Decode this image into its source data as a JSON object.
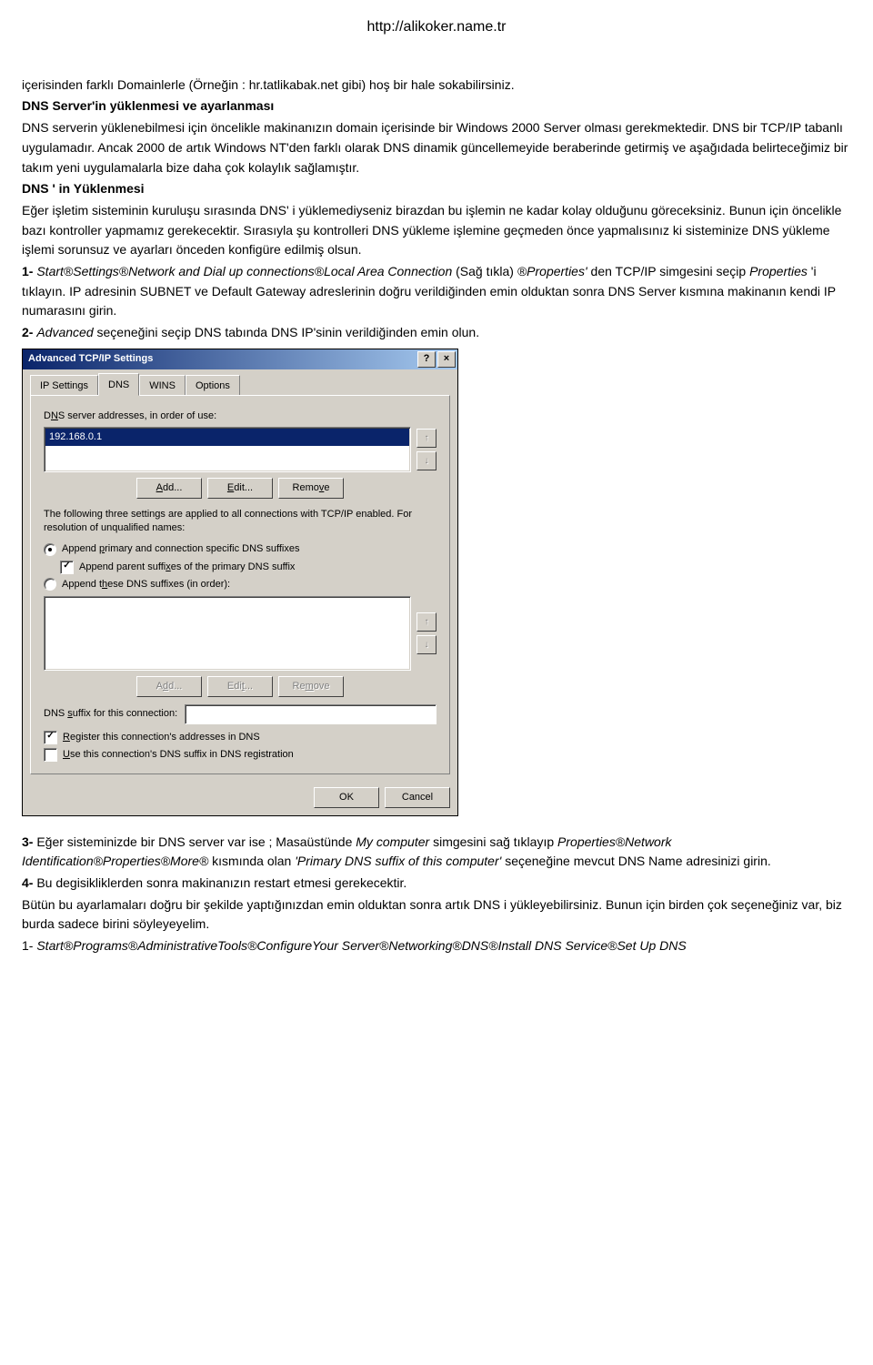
{
  "header_url": "http://alikoker.name.tr",
  "doc": {
    "p1": "içerisinden farklı Domainlerle (Örneğin : hr.tatlikabak.net gibi) hoş bir hale sokabilirsiniz.",
    "h1": "DNS Server'in yüklenmesi ve ayarlanması",
    "p2": "DNS serverin yüklenebilmesi için öncelikle makinanızın domain içerisinde bir Windows 2000 Server olması gerekmektedir. DNS bir TCP/IP tabanlı uygulamadır. Ancak 2000 de artık Windows NT'den farklı olarak DNS dinamik güncellemeyide beraberinde getirmiş ve aşağıdada belirteceğimiz bir takım yeni uygulamalarla bize daha çok kolaylık sağlamıştır.",
    "h2": "DNS ' in Yüklenmesi",
    "p3": "Eğer işletim sisteminin kuruluşu sırasında DNS' i yüklemediyseniz birazdan bu işlemin ne kadar kolay olduğunu göreceksiniz. Bunun için öncelikle bazı kontroller yapmamız gerekecektir. Sırasıyla şu kontrolleri DNS yükleme işlemine geçmeden önce yapmalısınız ki sisteminize DNS yükleme işlemi sorunsuz ve ayarları önceden konfigüre edilmiş olsun.",
    "step1_a": "1- ",
    "step1_i": "Start®Settings®Network and Dial up connections®Local Area Connection",
    "step1_b": "(Sağ tıkla) ",
    "step1_i2": "®Properties'",
    "step1_c": " den TCP/IP simgesini seçip ",
    "step1_i3": "Properties",
    "step1_d": "'i tıklayın. IP adresinin SUBNET ve Default Gateway adreslerinin doğru verildiğinden emin olduktan sonra DNS Server kısmına makinanın kendi IP numarasını girin.",
    "step2_a": "2- ",
    "step2_i": "Advanced",
    "step2_b": " seçeneğini seçip DNS tabında DNS IP'sinin verildiğinden emin olun.",
    "step3_a": "3- ",
    "step3_b": "Eğer sisteminizde bir DNS server var ise ; Masaüstünde ",
    "step3_i1": "My computer",
    "step3_c": " simgesini sağ tıklayıp ",
    "step3_i2": "Properties®Network Identification®Properties®More®",
    "step3_d": " kısmında olan ",
    "step3_i3": "'Primary DNS suffix of this computer'",
    "step3_e": " seçeneğine mevcut DNS Name adresinizi girin.",
    "step4_a": "4- ",
    "step4_b": "Bu degisikliklerden sonra makinanızın restart etmesi gerekecektir.",
    "p4": "Bütün bu ayarlamaları doğru bir şekilde yaptığınızdan emin olduktan sonra artık DNS i yükleyebilirsiniz. Bunun için birden çok seçeneğiniz var, biz burda sadece birini söyleyeyelim.",
    "p5_a": "1- ",
    "p5_i": "Start®Programs®AdministrativeTools®ConfigureYour Server®Networking®DNS®Install DNS Service®Set Up DNS"
  },
  "dialog": {
    "title": "Advanced TCP/IP Settings",
    "help_glyph": "?",
    "close_glyph": "×",
    "tabs": [
      "IP Settings",
      "DNS",
      "WINS",
      "Options"
    ],
    "active_tab": 1,
    "lbl_servers": "DNS server addresses, in order of use:",
    "lbl_servers_ukey": "N",
    "server_item": "192.168.0.1",
    "btn_add": "Add...",
    "btn_add_ukey": "A",
    "btn_edit": "Edit...",
    "btn_edit_ukey": "E",
    "btn_remove": "Remove",
    "btn_remove_ukey": "v",
    "para_three": "The following three settings are applied to all connections with TCP/IP enabled. For resolution of unqualified names:",
    "radio1": "Append primary and connection specific DNS suffixes",
    "radio1_ukey": "p",
    "check_parent": "Append parent suffixes of the primary DNS suffix",
    "check_parent_ukey": "x",
    "radio2": "Append these DNS suffixes (in order):",
    "radio2_ukey": "h",
    "btn_add2": "Add...",
    "btn_add2_ukey": "d",
    "btn_edit2": "Edit...",
    "btn_edit2_ukey": "t",
    "btn_remove2": "Remove",
    "btn_remove2_ukey": "m",
    "lbl_suffix": "DNS suffix for this connection:",
    "lbl_suffix_ukey": "s",
    "check_register": "Register this connection's addresses in DNS",
    "check_register_ukey": "R",
    "check_usesuffix": "Use this connection's DNS suffix in DNS registration",
    "check_usesuffix_ukey": "U",
    "btn_ok": "OK",
    "btn_cancel": "Cancel",
    "arrow_up": "↑",
    "arrow_down": "↓"
  }
}
